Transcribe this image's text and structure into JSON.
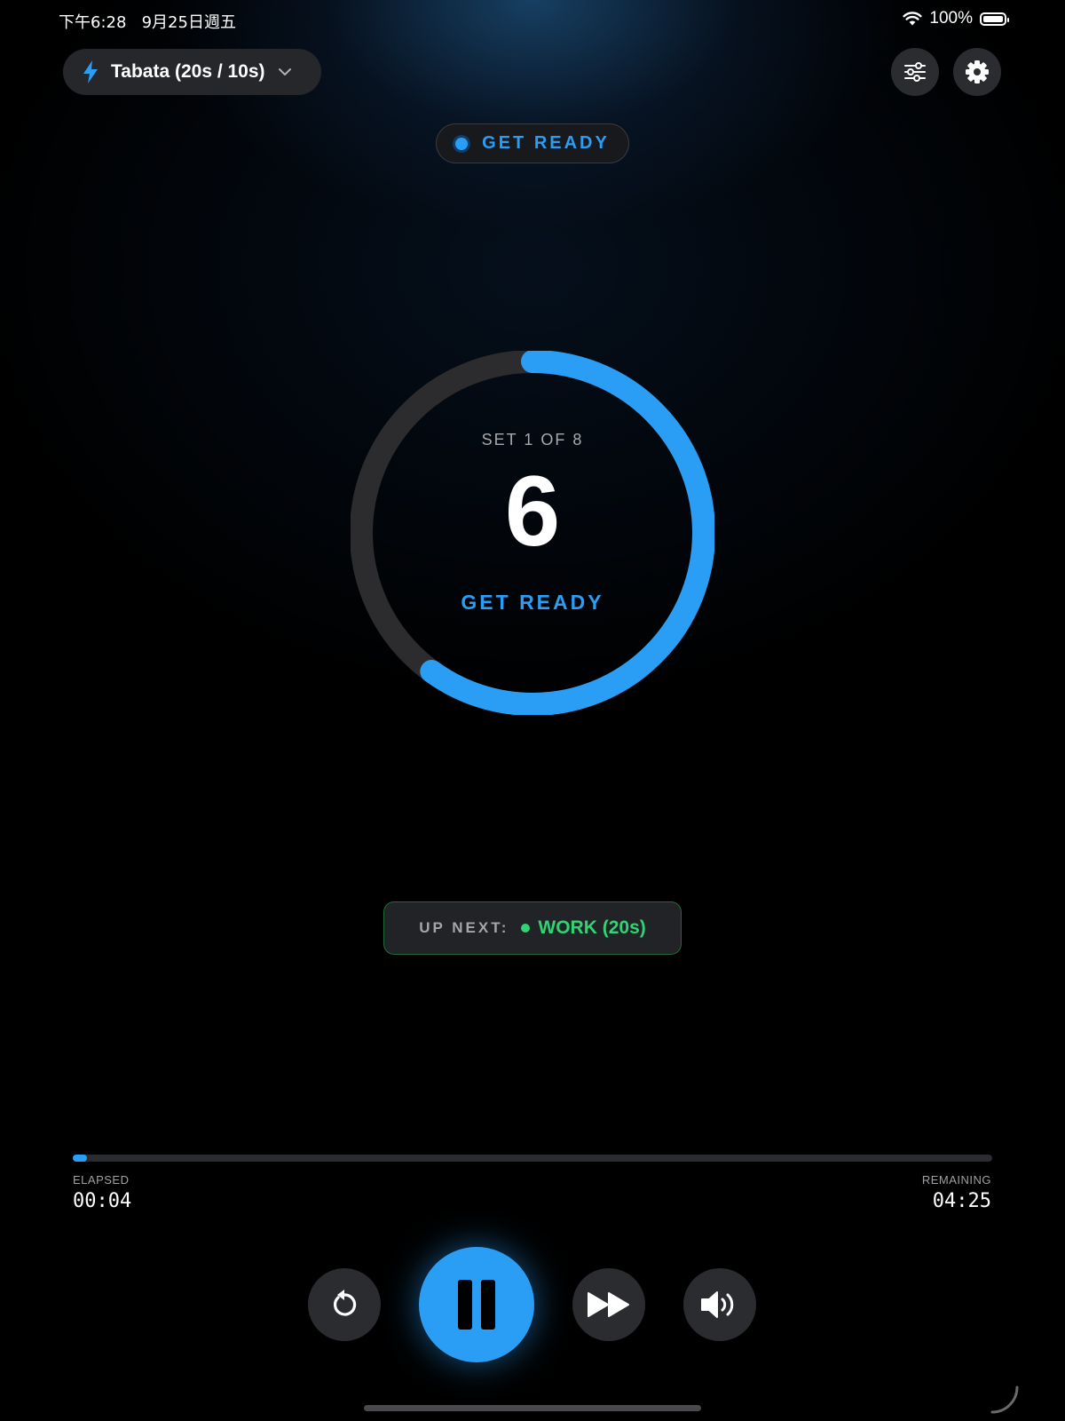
{
  "status_bar": {
    "time": "下午6:28",
    "date": "9月25日週五",
    "battery": "100%",
    "icons": [
      "wifi-icon",
      "battery-icon"
    ]
  },
  "header": {
    "preset_label": "Tabata (20s / 10s)",
    "preset_icon": "lightning-bolt-icon",
    "dropdown_icon": "chevron-down-icon",
    "buttons": [
      "sliders-icon",
      "gear-icon"
    ]
  },
  "phase": {
    "label": "GET READY",
    "color": "#2a9df4"
  },
  "ring": {
    "set_label": "SET 1 OF 8",
    "countdown": "6",
    "phase_label": "GET READY",
    "progress_fraction": 0.6
  },
  "up_next": {
    "label": "UP NEXT:",
    "value": "WORK (20s)",
    "color": "#2ed573"
  },
  "progress": {
    "elapsed_caption": "ELAPSED",
    "elapsed": "00:04",
    "remaining_caption": "REMAINING",
    "remaining": "04:25",
    "fraction": 0.015
  },
  "controls": {
    "icons": [
      "restart-icon",
      "pause-icon",
      "skip-forward-icon",
      "volume-icon"
    ]
  },
  "colors": {
    "accent": "#2a9df4",
    "work": "#2ed573",
    "background": "#000000"
  }
}
